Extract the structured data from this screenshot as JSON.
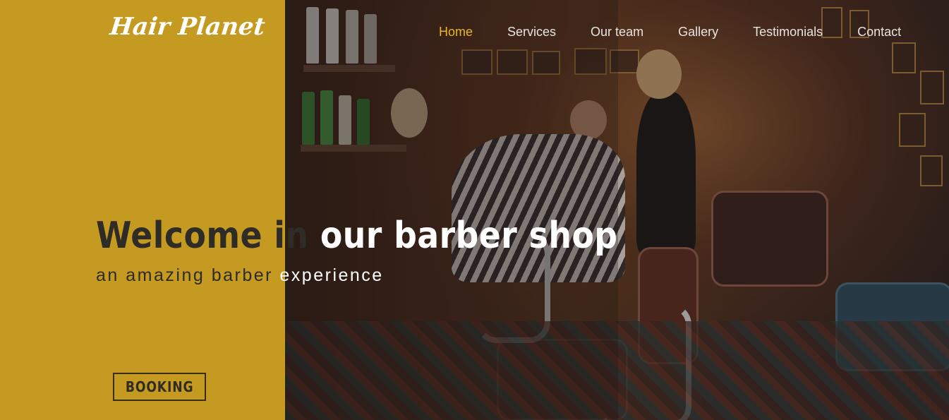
{
  "brand": {
    "name": "Hair Planet"
  },
  "nav": {
    "items": [
      {
        "label": "Home",
        "active": true
      },
      {
        "label": "Services",
        "active": false
      },
      {
        "label": "Our team",
        "active": false
      },
      {
        "label": "Gallery",
        "active": false
      },
      {
        "label": "Testimonials",
        "active": false
      },
      {
        "label": "Contact",
        "active": false
      }
    ]
  },
  "hero": {
    "title_part1": "Welcome in ",
    "title_part2": "our barber shop",
    "subtitle_part1": "an amazing barber ",
    "subtitle_part2": "experience",
    "booking_label": "BOOKING"
  },
  "colors": {
    "gold_panel": "#c49a21",
    "nav_active": "#e8b628",
    "nav_text": "#e8e4e0",
    "dark_text": "#2f2b26",
    "light_text": "#ffffff"
  },
  "background": {
    "image": "barber-shop-interior-photo"
  }
}
